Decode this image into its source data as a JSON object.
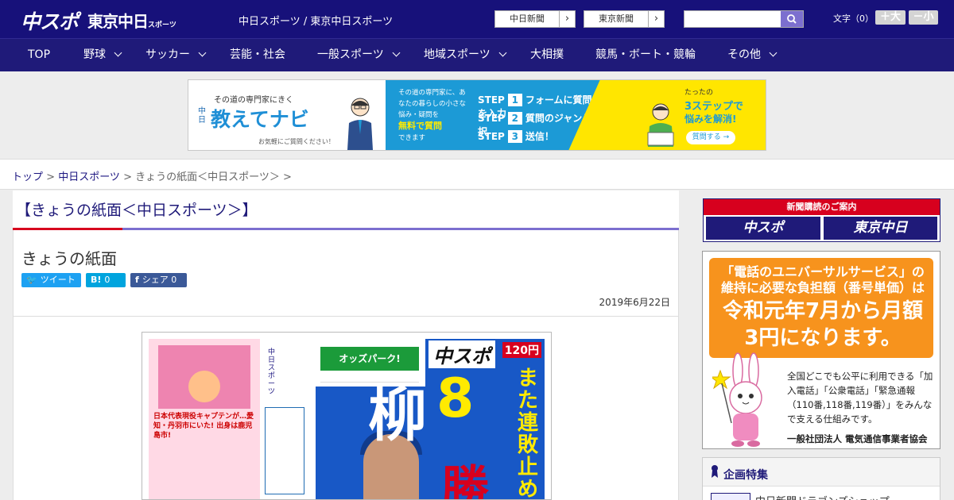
{
  "header": {
    "logo_chusupo": "中スポ",
    "logo_tokyo": "東京中日",
    "logo_tokyo_small": "スポーツ",
    "site_names": "中日スポーツ / 東京中日スポーツ",
    "link_chunichi": "中日新聞",
    "link_tokyo": "東京新聞",
    "search_placeholder": "",
    "font_size_label": "文字（0）",
    "font_bigger": "＋大",
    "font_smaller": "－小"
  },
  "nav": {
    "items": [
      {
        "label": "TOP",
        "has_menu": false
      },
      {
        "label": "野球",
        "has_menu": true
      },
      {
        "label": "サッカー",
        "has_menu": true
      },
      {
        "label": "芸能・社会",
        "has_menu": false
      },
      {
        "label": "一般スポーツ",
        "has_menu": true
      },
      {
        "label": "地域スポーツ",
        "has_menu": true
      },
      {
        "label": "大相撲",
        "has_menu": false
      },
      {
        "label": "競馬・ボート・競輪",
        "has_menu": false
      },
      {
        "label": "その他",
        "has_menu": true
      }
    ]
  },
  "banner": {
    "tagline": "その道の専門家にきく",
    "chunichi": "中日",
    "title": "教えてナビ",
    "note": "お気軽にご質問ください！",
    "mid_text": "その道の専門家に、あなたの暮らしの小さな悩み・疑問を",
    "mid_highlight": "無料で質問",
    "mid_tail": "できます",
    "steps": [
      {
        "num": "1",
        "label": "フォームに質問内容を入力"
      },
      {
        "num": "2",
        "label": "質問のジャンルを選択"
      },
      {
        "num": "3",
        "label": "送信！"
      }
    ],
    "step_word": "STEP",
    "right_small": "たったの",
    "right_big": "3ステップで",
    "right_sub": "悩みを解消!",
    "right_button": "質問する →"
  },
  "breadcrumb": {
    "top": "トップ",
    "sep": " > ",
    "section": "中日スポーツ",
    "current": "きょうの紙面＜中日スポーツ＞ >"
  },
  "main": {
    "page_title": "【きょうの紙面＜中日スポーツ＞】",
    "article_title": "きょうの紙面",
    "share": {
      "tweet": "ツイート",
      "hatena_count": "0",
      "hatena_icon": "B!",
      "facebook": "シェア 0",
      "fb_icon": "f"
    },
    "date": "2019年6月22日",
    "paper": {
      "logo": "中スポ",
      "price": "120円",
      "headline_big": "柳",
      "headline_num": "8",
      "headline_vert": "また連敗止め",
      "headline_win": "勝",
      "odds_park": "オッズパーク!",
      "left_text": "日本代表現役キャプテンが…愛知・丹羽市にいた! 出身は鹿児島市!",
      "col_vert": "中日スポーツ"
    }
  },
  "sidebar": {
    "subscribe_header": "新聞購読のご案内",
    "sub_logo1": "中スポ",
    "sub_logo2": "東京中日",
    "universal": {
      "line1": "「電話のユニバーサルサービス」の維持に必要な負担額（番号単価）は",
      "line2": "令和元年7月から月額3円になります。",
      "body": "全国どこでも公平に利用できる「加入電話」「公衆電話」「緊急通報（110番,118番,119番）」をみんなで支える仕組みです。",
      "footer": "一般社団法人 電気通信事業者協会"
    },
    "kikaku": {
      "header": "企画特集",
      "item": "中日新聞ドラゴンズショップ"
    }
  },
  "colors": {
    "header_bg": "#17117a",
    "nav_bg": "#1f1a79",
    "accent_red": "#d7001e",
    "accent_purple": "#7c6fcf"
  }
}
